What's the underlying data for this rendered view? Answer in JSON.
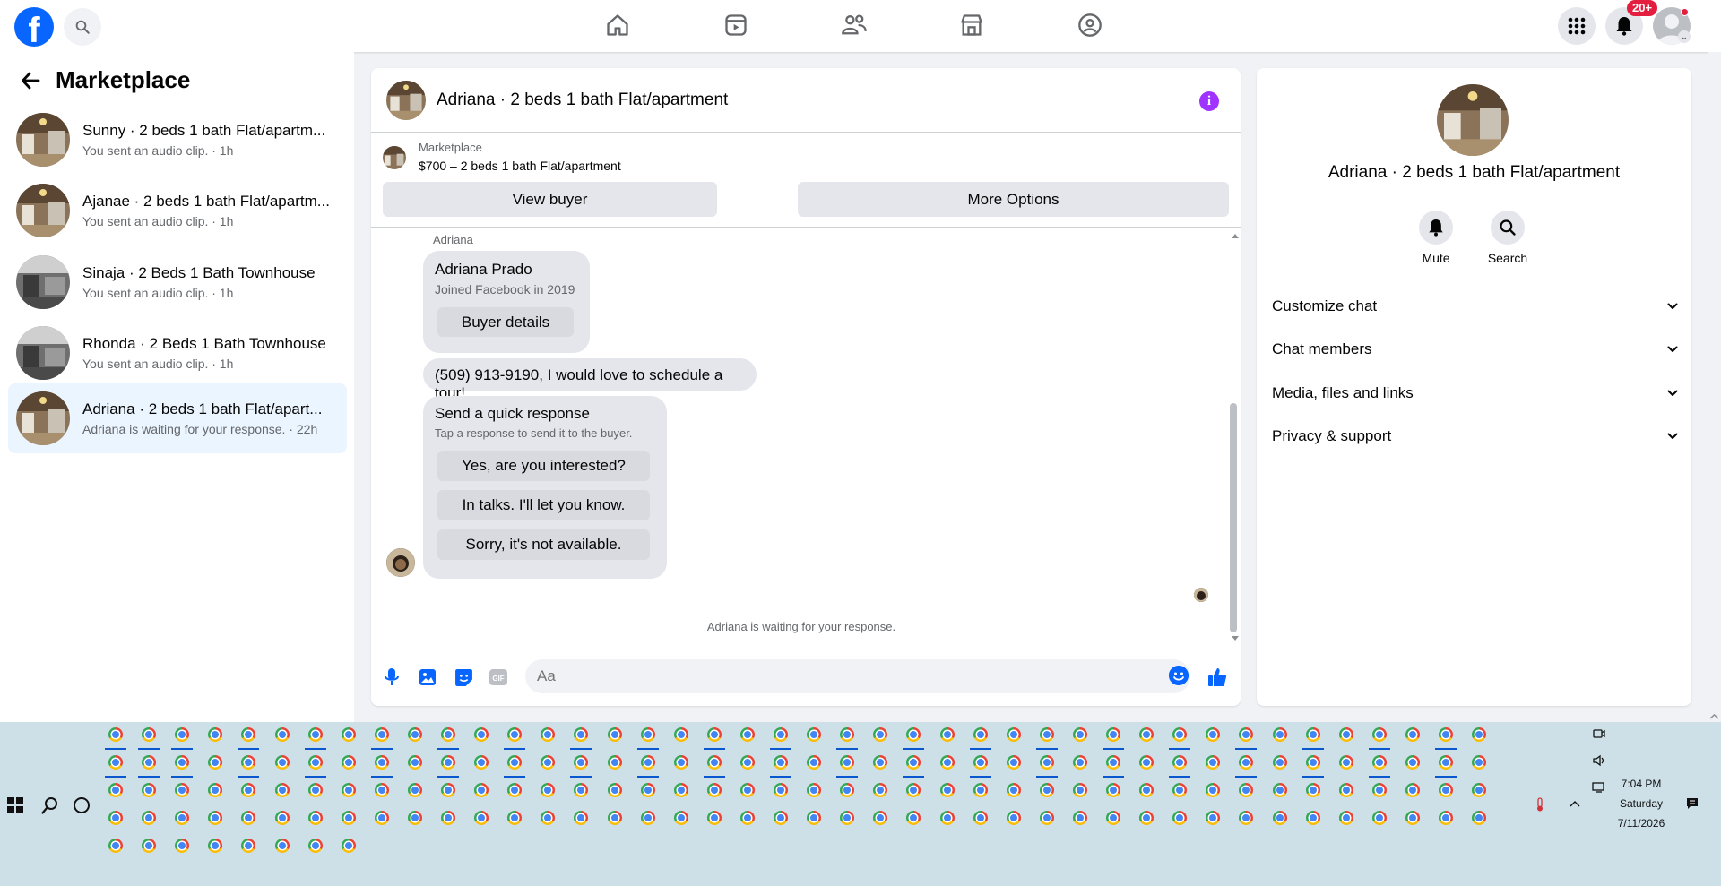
{
  "topbar": {
    "logo_letter": "f",
    "notif_badge": "20+",
    "nav_icons": [
      "home-icon",
      "video-icon",
      "friends-icon",
      "marketplace-icon",
      "groups-icon"
    ],
    "colors": {
      "brand": "#0866ff",
      "badge": "#e41e3f"
    }
  },
  "sidebar": {
    "title": "Marketplace",
    "conversations": [
      {
        "title": "Sunny · 2 beds 1 bath Flat/apartm...",
        "subtitle": "You sent an audio clip. · 1h"
      },
      {
        "title": "Ajanae · 2 beds 1 bath Flat/apartm...",
        "subtitle": "You sent an audio clip. · 1h"
      },
      {
        "title": "Sinaja · 2 Beds 1 Bath Townhouse",
        "subtitle": "You sent an audio clip. · 1h"
      },
      {
        "title": "Rhonda · 2 Beds 1 Bath Townhouse",
        "subtitle": "You sent an audio clip. · 1h"
      },
      {
        "title": "Adriana · 2 beds 1 bath Flat/apart...",
        "subtitle": "Adriana is waiting for your response. · 22h"
      }
    ]
  },
  "chat": {
    "header_title": "Adriana · 2 beds 1 bath Flat/apartment",
    "marketplace_label": "Marketplace",
    "listing_price": "$700 – 2 beds 1 bath Flat/apartment",
    "view_buyer_label": "View buyer",
    "more_options_label": "More Options",
    "sender_name": "Adriana",
    "profile_card": {
      "name": "Adriana Prado",
      "joined": "Joined Facebook in 2019",
      "button": "Buyer details"
    },
    "message": "(509) 913-9190, I would love to schedule a tour!",
    "quick_response": {
      "title": "Send a quick response",
      "subtitle": "Tap a response to send it to the buyer.",
      "options": [
        "Yes, are you interested?",
        "In talks. I'll let you know.",
        "Sorry, it's not available."
      ]
    },
    "waiting_text": "Adriana is waiting for your response.",
    "composer_placeholder": "Aa"
  },
  "right_panel": {
    "title": "Adriana · 2 beds 1 bath Flat/apartment",
    "mute_label": "Mute",
    "search_label": "Search",
    "sections": [
      "Customize chat",
      "Chat members",
      "Media, files and links",
      "Privacy & support"
    ]
  },
  "taskbar": {
    "time": "7:04 PM",
    "day": "Saturday",
    "date": "7/11/2026"
  }
}
